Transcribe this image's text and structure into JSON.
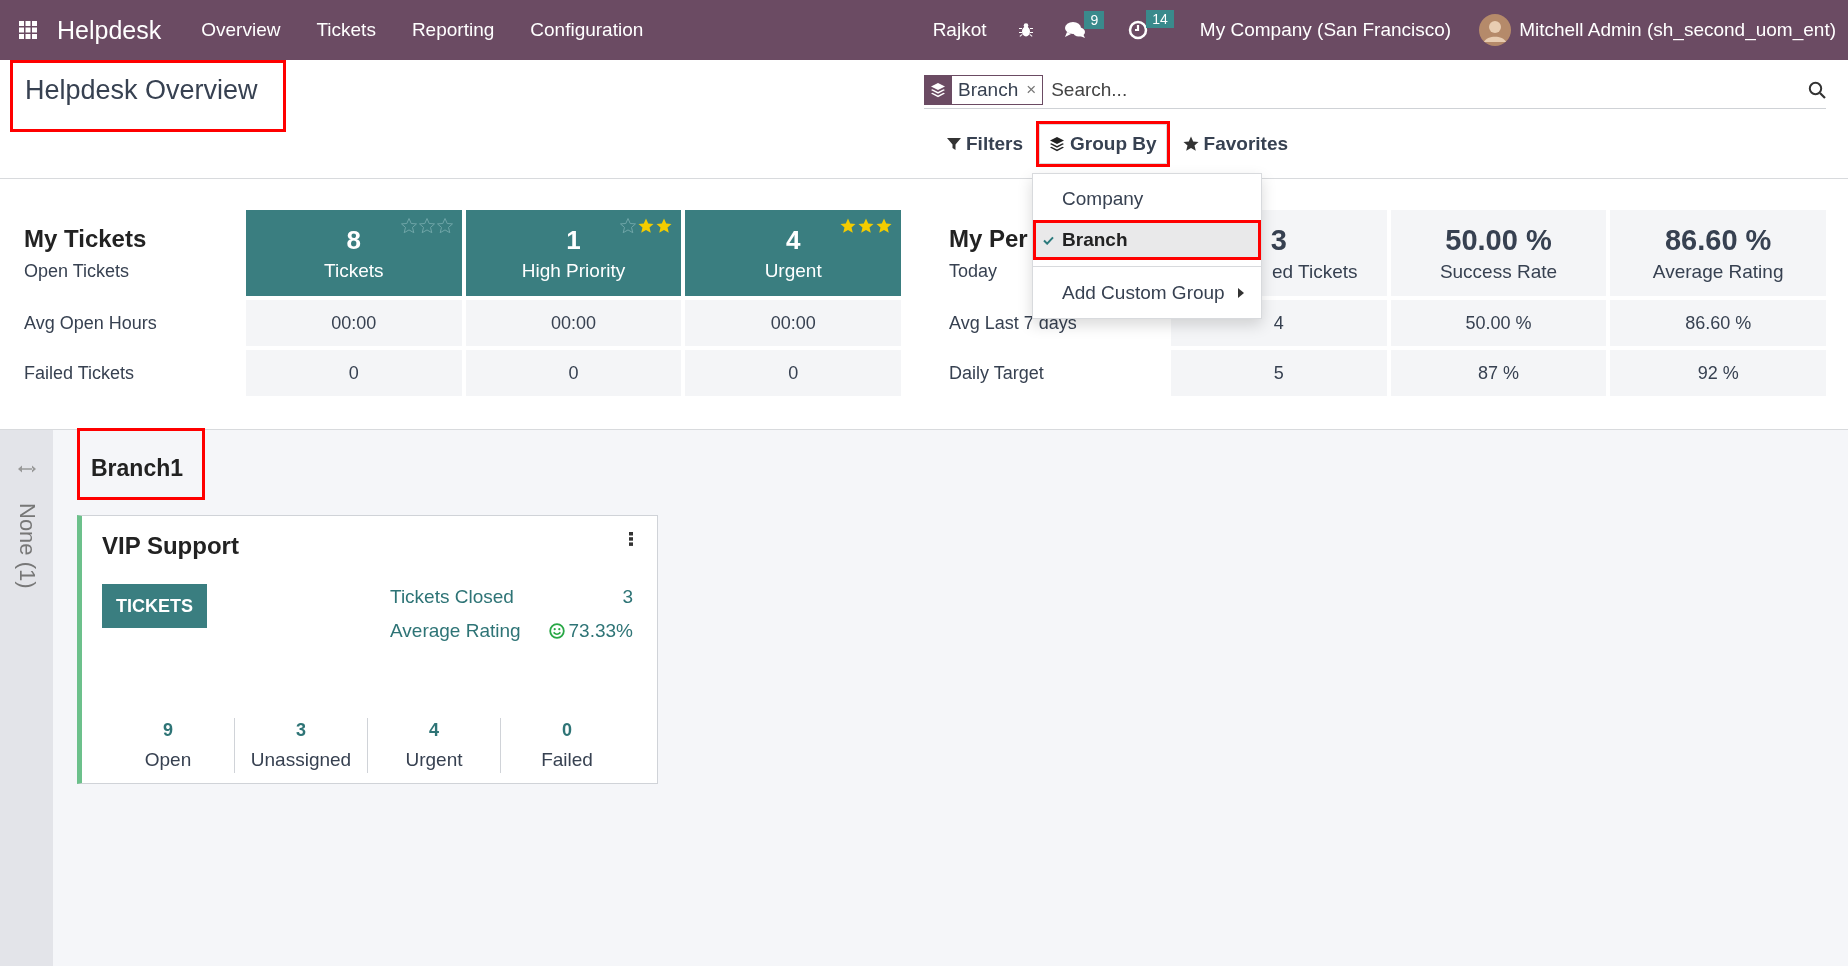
{
  "navbar": {
    "app_name": "Helpdesk",
    "menu": [
      "Overview",
      "Tickets",
      "Reporting",
      "Configuration"
    ],
    "systray": {
      "branch": "Rajkot",
      "messages_badge": "9",
      "activities_badge": "14",
      "company": "My Company (San Francisco)",
      "user": "Mitchell Admin (sh_second_uom_ent)"
    }
  },
  "control_panel": {
    "title": "Helpdesk Overview",
    "title_highlighted": true,
    "search": {
      "facet": "Branch",
      "facet_remove": "×",
      "placeholder": "Search..."
    },
    "buttons": [
      {
        "label": "Filters",
        "kind": "filter",
        "open": false,
        "highlighted": false
      },
      {
        "label": "Group By",
        "kind": "group",
        "open": true,
        "highlighted": true
      },
      {
        "label": "Favorites",
        "kind": "star",
        "open": false,
        "highlighted": false
      }
    ]
  },
  "group_by_menu": {
    "items": [
      {
        "label": "Company",
        "selected": false,
        "highlighted": false
      },
      {
        "label": "Branch",
        "selected": true,
        "highlighted": true
      }
    ],
    "custom_group": "Add Custom Group"
  },
  "my_tickets": {
    "title": "My Tickets",
    "subtitle": "Open Tickets",
    "row_labels": [
      "Avg Open Hours",
      "Failed Tickets"
    ],
    "columns": [
      {
        "value": "8",
        "label": "Tickets",
        "stars": 0,
        "row_values": [
          "00:00",
          "0"
        ]
      },
      {
        "value": "1",
        "label": "High Priority",
        "stars": 2,
        "row_values": [
          "00:00",
          "0"
        ]
      },
      {
        "value": "4",
        "label": "Urgent",
        "stars": 3,
        "row_values": [
          "00:00",
          "0"
        ]
      }
    ]
  },
  "my_performance": {
    "title": "My Per",
    "subtitle": "Today",
    "row_labels": [
      "Avg Last 7 days",
      "Daily Target"
    ],
    "columns": [
      {
        "value": "3",
        "label": "ed Tickets",
        "row_values": [
          "4",
          "5"
        ]
      },
      {
        "value": "50.00 %",
        "label": "Success Rate",
        "row_values": [
          "50.00 %",
          "87 %"
        ]
      },
      {
        "value": "86.60 %",
        "label": "Average Rating",
        "row_values": [
          "86.60 %",
          "92 %"
        ]
      }
    ]
  },
  "kanban": {
    "folded_column": {
      "label": "None (1)"
    },
    "groups": [
      {
        "name": "Branch1",
        "highlighted": true,
        "cards": [
          {
            "name": "VIP Support",
            "button": "TICKETS",
            "stats": [
              {
                "label": "Tickets Closed",
                "value": "3",
                "kind": "plain"
              },
              {
                "label": "Average Rating",
                "value": "73.33%",
                "kind": "rating"
              }
            ],
            "counters": [
              {
                "value": "9",
                "label": "Open"
              },
              {
                "value": "3",
                "label": "Unassigned"
              },
              {
                "value": "4",
                "label": "Urgent"
              },
              {
                "value": "0",
                "label": "Failed"
              }
            ]
          }
        ]
      }
    ]
  }
}
